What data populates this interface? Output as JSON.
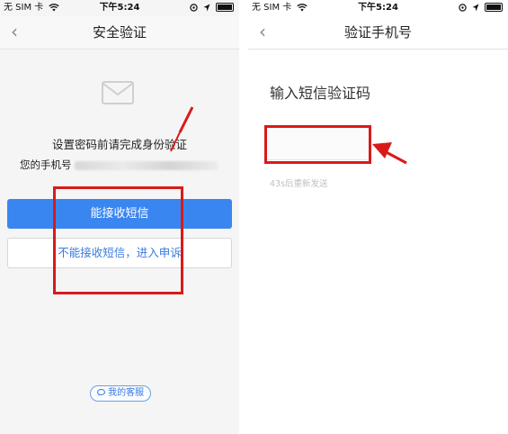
{
  "left_phone": {
    "status": {
      "carrier": "无 SIM 卡",
      "time": "下午5:24"
    },
    "nav": {
      "back": "‹",
      "title": "安全验证"
    },
    "heading": "设置密码前请完成身份验证",
    "phone_prefix": "您的手机号",
    "btn_receive": "能接收短信",
    "btn_cannot": "不能接收短信，进入申诉",
    "service": "我的客服"
  },
  "right_phone": {
    "status": {
      "carrier": "无 SIM 卡",
      "time": "下午5:24"
    },
    "nav": {
      "back": "‹",
      "title": "验证手机号"
    },
    "sms_title": "输入短信验证码",
    "code_value": "",
    "resend": "43s后重新发送"
  },
  "colors": {
    "primary": "#3a86f0",
    "link": "#3a7be0",
    "annotation": "#d91a1a"
  },
  "icons": [
    "back-chevron-icon",
    "wifi-icon",
    "lock-icon",
    "location-icon",
    "battery-icon",
    "mail-icon",
    "chat-bubble-icon",
    "arrow-annotation-icon"
  ]
}
